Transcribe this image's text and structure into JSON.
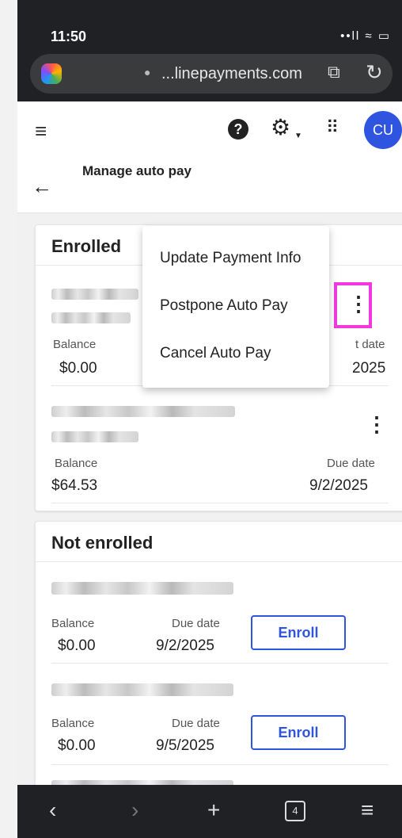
{
  "status": {
    "time": "11:50",
    "icons": "••ll ≈ ▭"
  },
  "browser": {
    "url": "...linepayments.com",
    "lock_icon": "lock-icon",
    "tab_icon": "reader-icon",
    "reload_icon": "reload-icon"
  },
  "appbar": {
    "avatar_initials": "CU"
  },
  "page": {
    "title": "Manage auto pay"
  },
  "enrolled": {
    "title": "Enrolled",
    "items": [
      {
        "balance_label": "Balance",
        "balance": "$0.00",
        "due_label": "t date",
        "due": "2025"
      },
      {
        "balance_label": "Balance",
        "balance": "$64.53",
        "due_label": "Due date",
        "due": "9/2/2025"
      }
    ]
  },
  "menu": {
    "items": [
      "Update Payment Info",
      "Postpone Auto Pay",
      "Cancel Auto Pay"
    ]
  },
  "not_enrolled": {
    "title": "Not enrolled",
    "items": [
      {
        "balance_label": "Balance",
        "balance": "$0.00",
        "due_label": "Due date",
        "due": "9/2/2025",
        "action": "Enroll"
      },
      {
        "balance_label": "Balance",
        "balance": "$0.00",
        "due_label": "Due date",
        "due": "9/5/2025",
        "action": "Enroll"
      }
    ]
  },
  "bottombar": {
    "tab_count": "4"
  }
}
